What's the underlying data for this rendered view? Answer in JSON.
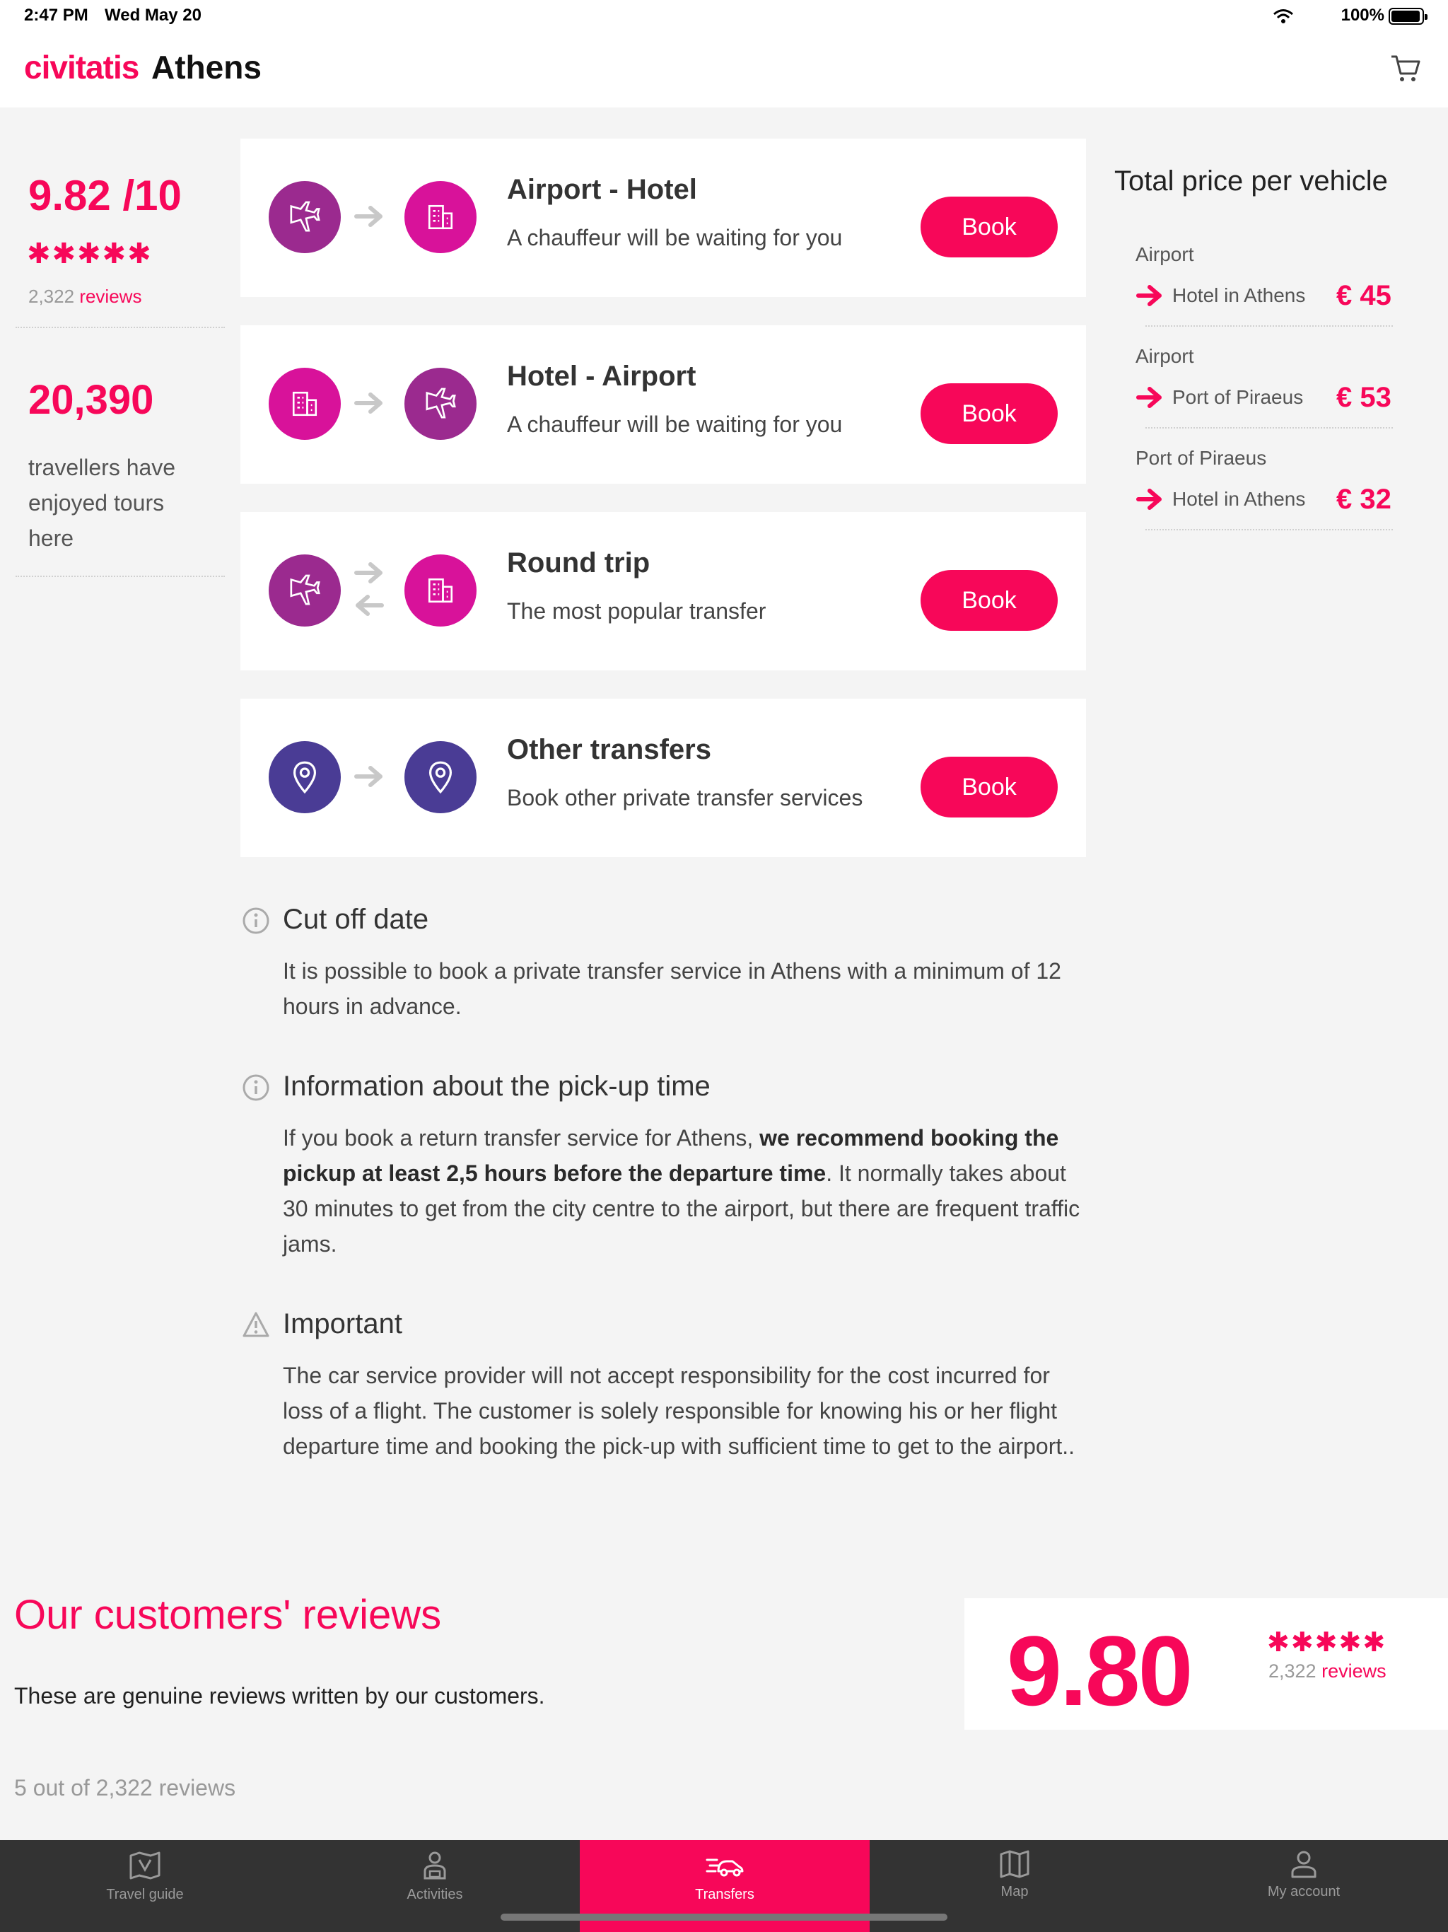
{
  "status": {
    "time": "2:47 PM",
    "date": "Wed May 20",
    "battery": "100%"
  },
  "header": {
    "brand": "civitatis",
    "city": "Athens"
  },
  "stats": {
    "rating": "9.82 /10",
    "stars": "✱✱✱✱✱",
    "reviews_count": "2,322",
    "reviews_word": "reviews",
    "travellers": "20,390",
    "travellers_text": "travellers have enjoyed tours here"
  },
  "transfers": [
    {
      "title": "Airport - Hotel",
      "subtitle": "A chauffeur will be waiting for you",
      "button": "Book"
    },
    {
      "title": "Hotel - Airport",
      "subtitle": "A chauffeur will be waiting for you",
      "button": "Book"
    },
    {
      "title": "Round trip",
      "subtitle": "The most popular transfer",
      "button": "Book"
    },
    {
      "title": "Other transfers",
      "subtitle": "Book other private transfer services",
      "button": "Book"
    }
  ],
  "prices": {
    "title": "Total price per vehicle",
    "routes": [
      {
        "from": "Airport",
        "to": "Hotel in Athens",
        "price": "€ 45"
      },
      {
        "from": "Airport",
        "to": "Port of Piraeus",
        "price": "€ 53"
      },
      {
        "from": "Port of Piraeus",
        "to": "Hotel in Athens",
        "price": "€ 32"
      }
    ]
  },
  "info": {
    "cutoff_title": "Cut off date",
    "cutoff_text": "It is possible to book a private transfer service in Athens with a minimum of 12 hours in advance.",
    "pickup_title": "Information about the pick-up time",
    "pickup_text_1": "If you book a return transfer service for Athens, ",
    "pickup_text_bold": "we recommend booking the pickup at least 2,5 hours before the departure time",
    "pickup_text_2": ". It normally takes about 30 minutes to get from the city centre to the airport, but there are frequent traffic jams.",
    "important_title": "Important",
    "important_text": "The car service provider will not accept responsibility for the cost incurred for loss of a flight. The customer is solely responsible for knowing his or her flight departure time and booking the pick-up with sufficient time to get to the airport.."
  },
  "reviews": {
    "title": "Our customers' reviews",
    "subtitle": "These are genuine reviews written by our customers.",
    "count_text": "5 out of 2,322 reviews",
    "score": "9.80",
    "stars": "✱✱✱✱✱",
    "reviews_count": "2,322",
    "reviews_word": "reviews"
  },
  "tabs": [
    {
      "label": "Travel guide",
      "icon": "guide-icon"
    },
    {
      "label": "Activities",
      "icon": "activities-icon"
    },
    {
      "label": "Transfers",
      "icon": "transfers-icon"
    },
    {
      "label": "Map",
      "icon": "map-icon"
    },
    {
      "label": "My account",
      "icon": "account-icon"
    }
  ],
  "colors": {
    "accent": "#f70759",
    "plane": "#9b2a8f",
    "building": "#d8129a",
    "location": "#4a3c95",
    "tabbar": "#333333"
  }
}
